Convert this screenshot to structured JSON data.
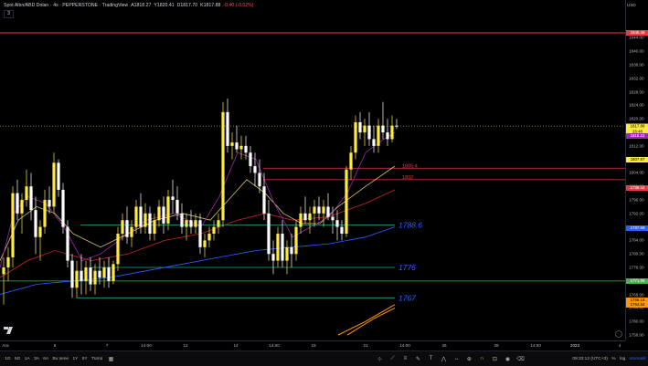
{
  "legend": {
    "title": "Spot Altın/ABD Doları · 4s · PEPPERSTONE · TradingView",
    "o": "A1818.27",
    "h": "Y1820.41",
    "l": "D1817.70",
    "c": "K1817.88",
    "change": "-0.40 (-0.02%)",
    "collapse": "3"
  },
  "currency": "USD",
  "price_ticks": [
    "1844.00",
    "1840.00",
    "1836.00",
    "1832.00",
    "1828.00",
    "1824.00",
    "1820.00",
    "1816.00",
    "1812.00",
    "1808.00",
    "1804.00",
    "1800.00",
    "1796.00",
    "1792.00",
    "1788.00",
    "1784.00",
    "1780.00",
    "1776.00",
    "1772.00",
    "1768.00",
    "1764.00",
    "1760.00",
    "1756.00"
  ],
  "price_labels": [
    {
      "text": "1845.48",
      "bg": "#f23645",
      "fg": "#ffffff",
      "price": 1845.48
    },
    {
      "text": "1807.87",
      "bg": "#ffeb3b",
      "fg": "#000000",
      "price": 1807.87
    },
    {
      "text": "1799.44",
      "bg": "#f23645",
      "fg": "#ffffff",
      "price": 1799.44
    },
    {
      "text": "1787.68",
      "bg": "#2962ff",
      "fg": "#ffffff",
      "price": 1787.68
    },
    {
      "text": "1771.98",
      "bg": "#4caf50",
      "fg": "#ffffff",
      "price": 1771.98
    },
    {
      "text": "1766.18",
      "bg": "#ff9800",
      "fg": "#000000",
      "price": 1766.18
    },
    {
      "text": "1764.84",
      "bg": "#ff9800",
      "fg": "#000000",
      "price": 1764.84
    }
  ],
  "current_price": {
    "price": "1817.88",
    "countdown": "26:48",
    "ma": "1815.22",
    "y_price": 1817.88
  },
  "time_ticks": [
    "Ara",
    "5",
    "7",
    "14:00",
    "12",
    "14",
    "14:00",
    "19",
    "21",
    "14:00",
    "26",
    "28",
    "14:00",
    "2023",
    "4"
  ],
  "annotations": [
    {
      "text": "1805.4",
      "color": "#f23645",
      "price": 1805.4,
      "size": "small"
    },
    {
      "text": "1802",
      "color": "#f23645",
      "price": 1802,
      "size": "small"
    },
    {
      "text": "1788.6",
      "color": "#2962ff",
      "price": 1788.6,
      "size": "large"
    },
    {
      "text": "1776",
      "color": "#2962ff",
      "price": 1776,
      "size": "large"
    },
    {
      "text": "1767",
      "color": "#2962ff",
      "price": 1767,
      "size": "large"
    }
  ],
  "toolbar": {
    "ranges": [
      "1G",
      "5G",
      "1A",
      "3A",
      "6A",
      "Bu sene",
      "1Y",
      "5Y",
      "Tümü"
    ],
    "time": "09:33:12 (UTC+3)",
    "log": "log",
    "auto": "otomatik"
  },
  "colors": {
    "bull": "#ffeb3b",
    "bear": "#ffffff",
    "ma_fast": "#9c27b0",
    "ma_mid": "#d7c460",
    "ma_red": "#c62828",
    "ma_blue": "#2962ff",
    "ma_orange": "#ff9800",
    "h_red": "#f23645",
    "h_green": "#4caf50",
    "h_teal": "#26a69a"
  }
}
